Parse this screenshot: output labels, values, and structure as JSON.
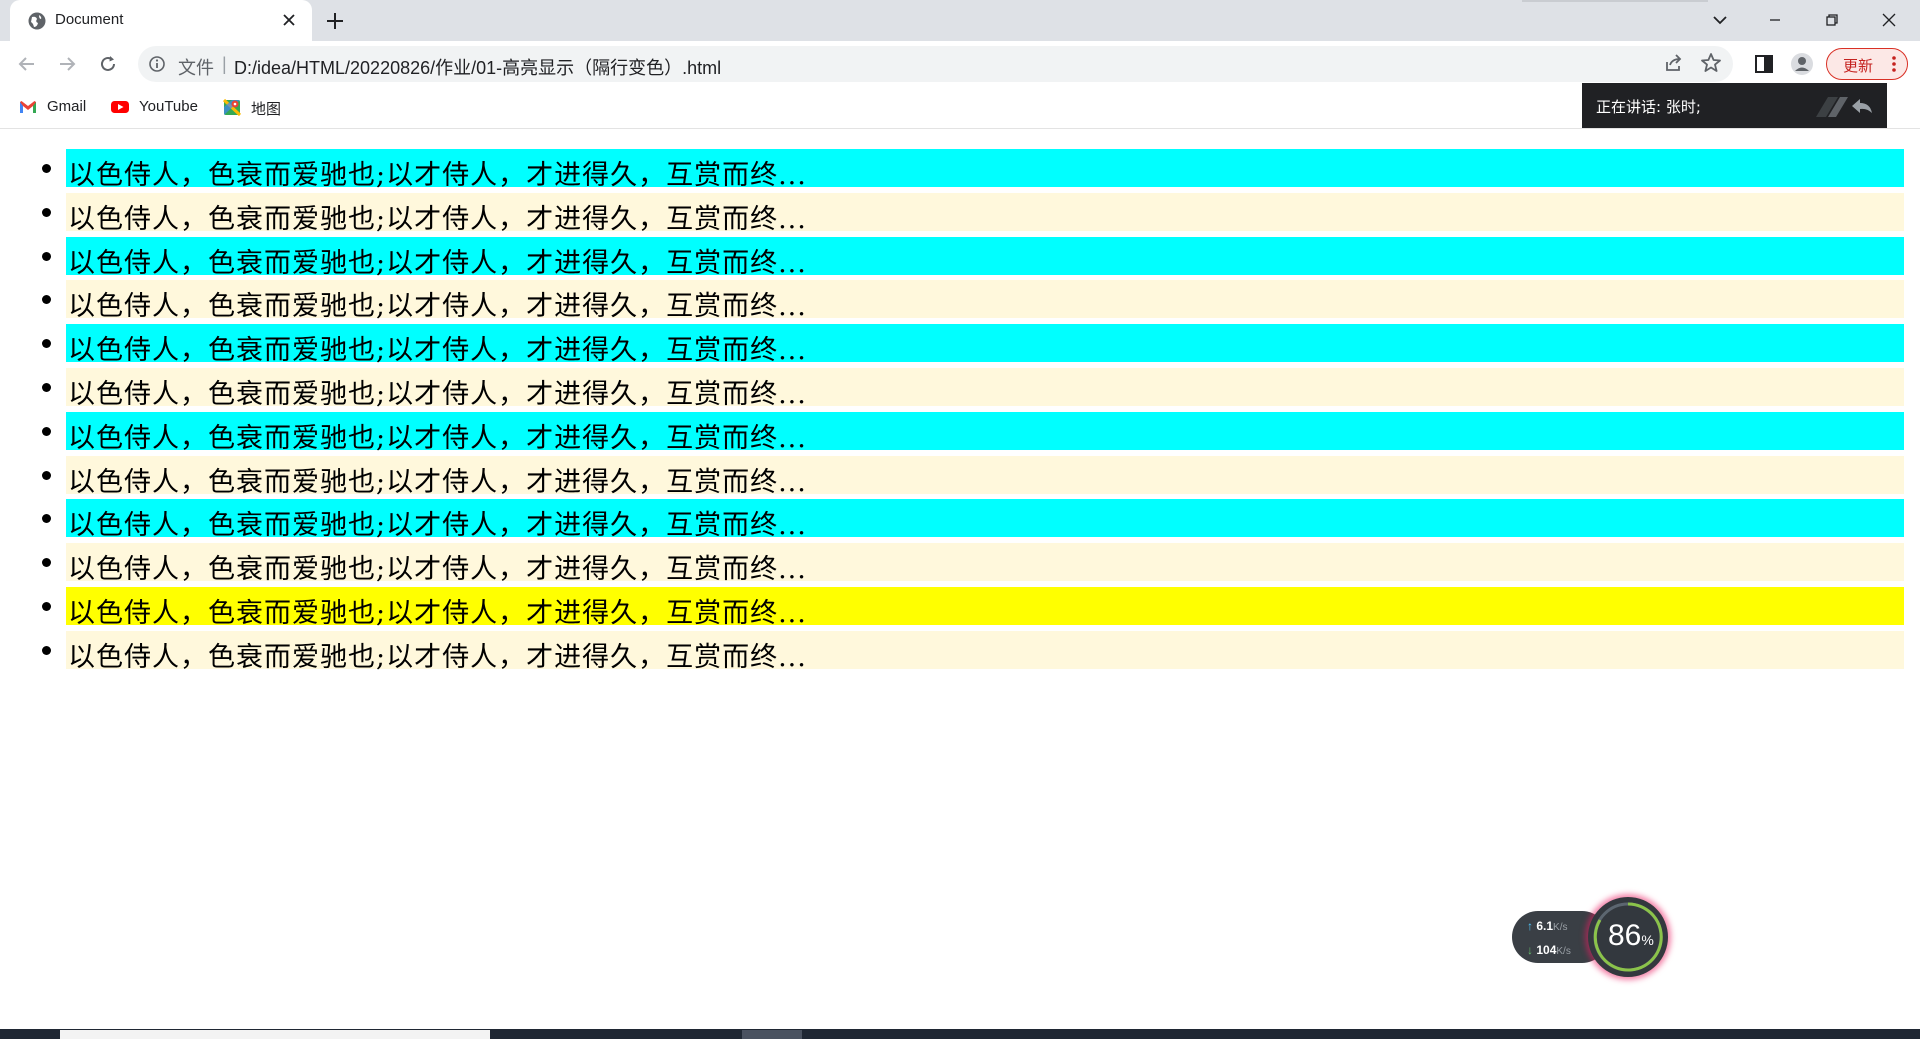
{
  "browser": {
    "tab": {
      "title": "Document"
    },
    "address": {
      "scheme_label": "文件",
      "separator": "|",
      "url": "D:/idea/HTML/20220826/作业/01-高亮显示（隔行变色）.html"
    },
    "update_button_label": "更新",
    "bookmarks": [
      {
        "label": "Gmail",
        "icon": "gmail-icon"
      },
      {
        "label": "YouTube",
        "icon": "youtube-icon"
      },
      {
        "label": "地图",
        "icon": "maps-icon"
      }
    ]
  },
  "speaking_overlay": {
    "text": "正在讲话: 张时;"
  },
  "page": {
    "items": [
      {
        "text": "以色侍人，色衰而爱驰也;以才侍人，才进得久，互赏而终...",
        "highlight": "#00ffff"
      },
      {
        "text": "以色侍人，色衰而爱驰也;以才侍人，才进得久，互赏而终...",
        "highlight": "#fff8dc"
      },
      {
        "text": "以色侍人，色衰而爱驰也;以才侍人，才进得久，互赏而终...",
        "highlight": "#00ffff"
      },
      {
        "text": "以色侍人，色衰而爱驰也;以才侍人，才进得久，互赏而终...",
        "highlight": "#fff8dc"
      },
      {
        "text": "以色侍人，色衰而爱驰也;以才侍人，才进得久，互赏而终...",
        "highlight": "#00ffff"
      },
      {
        "text": "以色侍人，色衰而爱驰也;以才侍人，才进得久，互赏而终...",
        "highlight": "#fff8dc"
      },
      {
        "text": "以色侍人，色衰而爱驰也;以才侍人，才进得久，互赏而终...",
        "highlight": "#00ffff"
      },
      {
        "text": "以色侍人，色衰而爱驰也;以才侍人，才进得久，互赏而终...",
        "highlight": "#fff8dc"
      },
      {
        "text": "以色侍人，色衰而爱驰也;以才侍人，才进得久，互赏而终...",
        "highlight": "#00ffff"
      },
      {
        "text": "以色侍人，色衰而爱驰也;以才侍人，才进得久，互赏而终...",
        "highlight": "#fff8dc"
      },
      {
        "text": "以色侍人，色衰而爱驰也;以才侍人，才进得久，互赏而终...",
        "highlight": "#ffff00"
      },
      {
        "text": "以色侍人，色衰而爱驰也;以才侍人，才进得久，互赏而终...",
        "highlight": "#fff8dc"
      }
    ]
  },
  "net_widget": {
    "upload_value": "6.1",
    "upload_unit": "K/s",
    "download_value": "104",
    "download_unit": "K/s",
    "percent_value": "86",
    "percent_unit": "%"
  }
}
